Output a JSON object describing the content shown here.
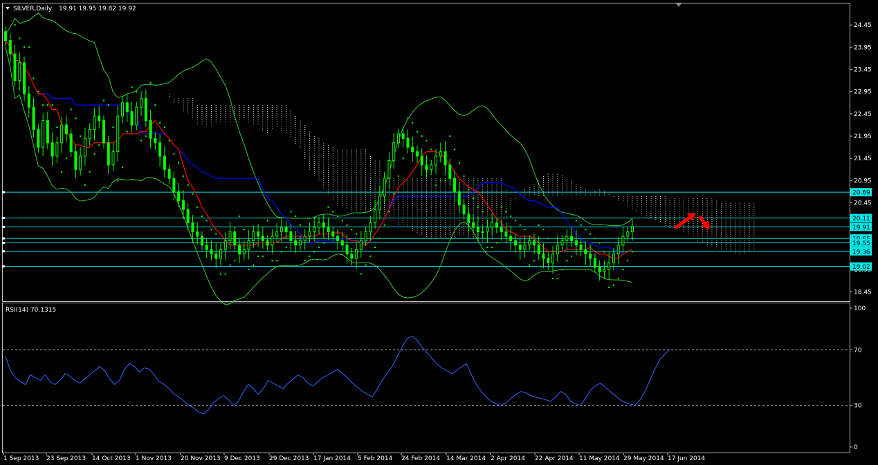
{
  "header": {
    "symbol": "SILVER,Daily",
    "ohlc": "19.91 19.95 19.82 19.92"
  },
  "rsi_panel": {
    "label": "RSI(14) 70.1315"
  },
  "colors": {
    "background": "#000000",
    "frame": "#c0c0c0",
    "candle": "#00ff00",
    "cloud": "#ffffff",
    "level_line": "#00e5e5",
    "level_box": "#00e5e5",
    "tenkan": "#ff0000",
    "kijun": "#0000ff",
    "bollinger": "#33cc33",
    "psar": "#00ff00",
    "rsi": "#3366ff",
    "arrow": "#ff0000"
  },
  "chart_data": [
    {
      "type": "line",
      "title": "SILVER,Daily",
      "y_ticks": [
        "24.45",
        "23.95",
        "23.45",
        "22.95",
        "22.45",
        "21.95",
        "21.45",
        "20.95",
        "20.45",
        "19.95",
        "19.45",
        "18.95",
        "18.45"
      ],
      "x_ticks": [
        "1 Sep 2013",
        "23 Sep 2013",
        "14 Oct 2013",
        "1 Nov 2013",
        "20 Nov 2013",
        "9 Dec 2013",
        "29 Dec 2013",
        "17 Jan 2014",
        "5 Feb 2014",
        "24 Feb 2014",
        "14 Mar 2014",
        "2 Apr 2014",
        "22 Apr 2014",
        "11 May 2014",
        "29 May 2014",
        "17 Jun 2014"
      ],
      "ylim": [
        18.3,
        24.7
      ],
      "levels": [
        "20.69",
        "20.11",
        "19.91",
        "19.65",
        "19.55",
        "19.36",
        "19.02"
      ],
      "series": [
        {
          "values": [
            24.1,
            23.8,
            23.2,
            23.6,
            22.9,
            22.6,
            22.1,
            21.7,
            22.3,
            21.8,
            21.5,
            21.8,
            22.2,
            22.0,
            21.6,
            21.2,
            21.5,
            21.9,
            22.1,
            22.4,
            22.3,
            21.8,
            21.3,
            21.6,
            22.4,
            22.7,
            22.5,
            22.2,
            22.6,
            22.8,
            22.3,
            21.9,
            21.8,
            21.5,
            21.2,
            21.0,
            20.7,
            20.5,
            20.3,
            20.0,
            19.8,
            19.7,
            19.5,
            19.4,
            19.3,
            19.2,
            19.4,
            19.6,
            19.8,
            19.5,
            19.3,
            19.4,
            19.6,
            19.8,
            19.7,
            19.6,
            19.5,
            19.7,
            19.8,
            19.9,
            19.8,
            19.6,
            19.5,
            19.6,
            19.7,
            19.8,
            19.9,
            20.0,
            19.9,
            19.8,
            19.7,
            19.6,
            19.5,
            19.3,
            19.2,
            19.4,
            19.6,
            19.8,
            20.0,
            20.3,
            20.6,
            21.0,
            21.4,
            21.8,
            22.0,
            21.9,
            21.7,
            21.6,
            21.5,
            21.3,
            21.2,
            21.3,
            21.5,
            21.6,
            21.3,
            21.0,
            20.7,
            20.4,
            20.2,
            20.0,
            19.9,
            19.8,
            19.8,
            19.9,
            20.0,
            19.9,
            19.8,
            19.7,
            19.6,
            19.5,
            19.4,
            19.5,
            19.6,
            19.5,
            19.3,
            19.2,
            19.1,
            19.3,
            19.5,
            19.6,
            19.7,
            19.6,
            19.5,
            19.4,
            19.3,
            19.2,
            19.0,
            18.9,
            18.95,
            19.1,
            19.3,
            19.5,
            19.7,
            19.8,
            19.92
          ]
        },
        {
          "name": "RSI(14)",
          "ylim": [
            0,
            100
          ],
          "y_ticks": [
            "100",
            "70",
            "30",
            "0"
          ],
          "values": [
            65,
            55,
            50,
            47,
            45,
            52,
            50,
            48,
            52,
            47,
            45,
            48,
            53,
            51,
            48,
            46,
            49,
            52,
            55,
            58,
            55,
            49,
            45,
            48,
            56,
            60,
            58,
            54,
            57,
            56,
            52,
            47,
            45,
            42,
            38,
            36,
            33,
            30,
            28,
            25,
            24,
            27,
            32,
            35,
            37,
            34,
            30,
            33,
            40,
            45,
            42,
            38,
            42,
            48,
            46,
            44,
            42,
            46,
            49,
            52,
            50,
            46,
            44,
            47,
            50,
            52,
            54,
            56,
            53,
            50,
            46,
            43,
            40,
            38,
            36,
            42,
            48,
            53,
            58,
            65,
            72,
            78,
            80,
            77,
            72,
            68,
            64,
            60,
            57,
            55,
            53,
            55,
            58,
            60,
            52,
            45,
            40,
            36,
            33,
            31,
            30,
            32,
            35,
            38,
            40,
            39,
            37,
            36,
            35,
            34,
            33,
            36,
            40,
            38,
            33,
            31,
            30,
            35,
            41,
            44,
            46,
            43,
            40,
            37,
            34,
            32,
            31,
            30,
            34,
            40,
            48,
            56,
            63,
            67,
            70.13
          ]
        }
      ]
    }
  ]
}
